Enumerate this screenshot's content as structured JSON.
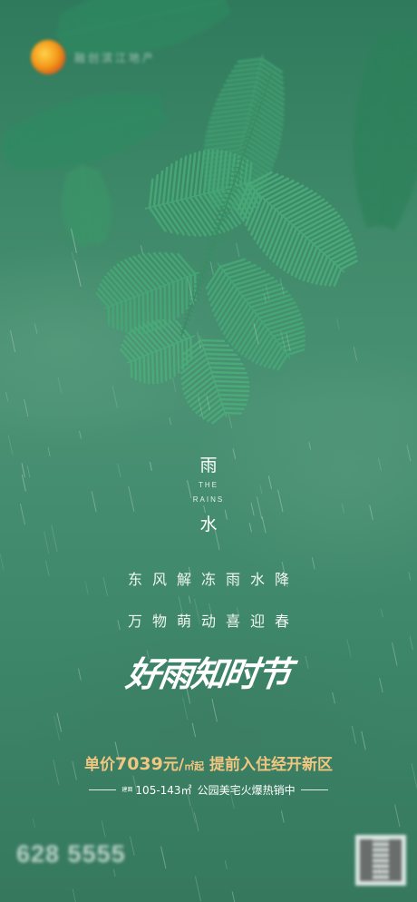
{
  "logo": {
    "text": "融创滨江地产",
    "icon": "sun-logo-icon"
  },
  "title": {
    "char_top": "雨",
    "en_line1": "THE",
    "en_line2": "RAINS",
    "char_bottom": "水"
  },
  "verse": {
    "line1": "东风解冻雨水降",
    "line2": "万物萌动喜迎春"
  },
  "calligraphy": "好雨知时节",
  "price": {
    "prefix": "单价",
    "amount": "7039",
    "currency": "元/",
    "unit": "㎡起",
    "slogan": "提前入住经开新区"
  },
  "area": {
    "tag": "建面",
    "range": "105-143㎡",
    "desc": "公园美宅火爆热销中"
  },
  "contact": {
    "phone": "628 5555",
    "qr_icon": "qr-code-icon"
  },
  "colors": {
    "background": "#3f8a6b",
    "price_gold": "#f0c680",
    "text_white": "#ffffff"
  }
}
